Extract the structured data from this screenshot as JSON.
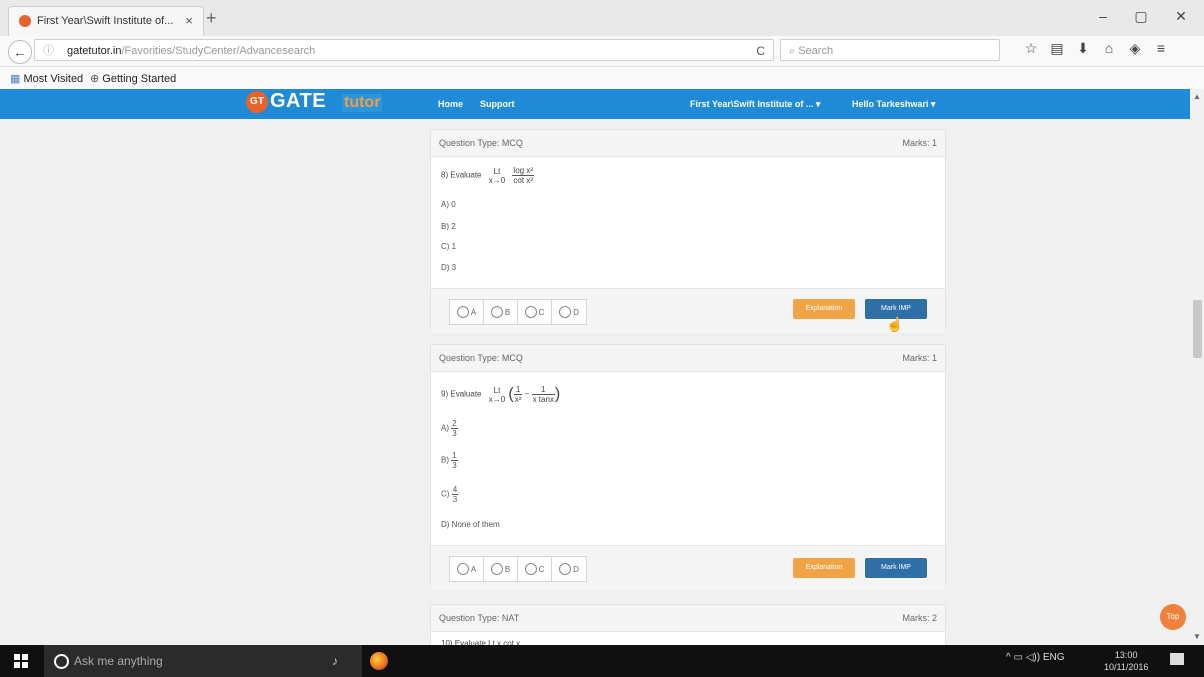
{
  "browser": {
    "tab_title": "First Year\\Swift Institute of...",
    "tab_close": "×",
    "new_tab": "+",
    "window_controls": [
      "–",
      "▢",
      "✕"
    ],
    "url_host": "gatetutor.in",
    "url_path": "/Favorities/StudyCenter/Advancesearch",
    "url_info_icon": "ⓘ",
    "reload_icon": "C",
    "search_placeholder": "Search",
    "toolbar_icons": [
      "☆",
      "▤",
      "⬇",
      "⌂",
      "◈",
      "≡"
    ],
    "bookmarks": [
      "Most Visited",
      "Getting Started"
    ]
  },
  "site": {
    "logo_badge": "GT",
    "logo_gate": "GATE",
    "logo_tutor": "tutor",
    "nav_left": [
      "Home",
      "Support"
    ],
    "nav_institute": "First Year\\Swift Institute of ... ▾",
    "nav_user": "Hello Tarkeshwari ▾",
    "top_button": "Top"
  },
  "questions": [
    {
      "type_label": "Question Type: MCQ",
      "marks_label": "Marks: 1",
      "number": "8)",
      "prompt": "Evaluate",
      "limit": "Lt",
      "limit_sub": "x→0",
      "expr_num": "log x²",
      "expr_den": "cot x²",
      "options": [
        "A) 0",
        "B) 2",
        "C) 1",
        "D) 3"
      ],
      "answer_letters": [
        "A",
        "B",
        "C",
        "D"
      ],
      "explanation_label": "Explanation",
      "mark_imp_label": "Mark IMP"
    },
    {
      "type_label": "Question Type: MCQ",
      "marks_label": "Marks: 1",
      "number": "9)",
      "prompt": "Evaluate",
      "limit": "Lt",
      "limit_sub": "x→0",
      "frac1_num": "1",
      "frac1_den": "x²",
      "minus": "−",
      "frac2_num": "1",
      "frac2_den": "x tanx",
      "options": [
        {
          "letter": "A)",
          "num": "2",
          "den": "3"
        },
        {
          "letter": "B)",
          "num": "1",
          "den": "3"
        },
        {
          "letter": "C)",
          "num": "4",
          "den": "3"
        }
      ],
      "option_d": "D) None of them",
      "answer_letters": [
        "A",
        "B",
        "C",
        "D"
      ],
      "explanation_label": "Explanation",
      "mark_imp_label": "Mark IMP"
    },
    {
      "type_label": "Question Type: NAT",
      "marks_label": "Marks: 2",
      "partial_text": "10) Evaluate   Lt    x cot x"
    }
  ],
  "taskbar": {
    "search_placeholder": "Ask me anything",
    "mic_icon": "🎤",
    "tray_text": "^  ▭  ◁))  ENG",
    "time": "13:00",
    "date": "10/11/2016"
  }
}
